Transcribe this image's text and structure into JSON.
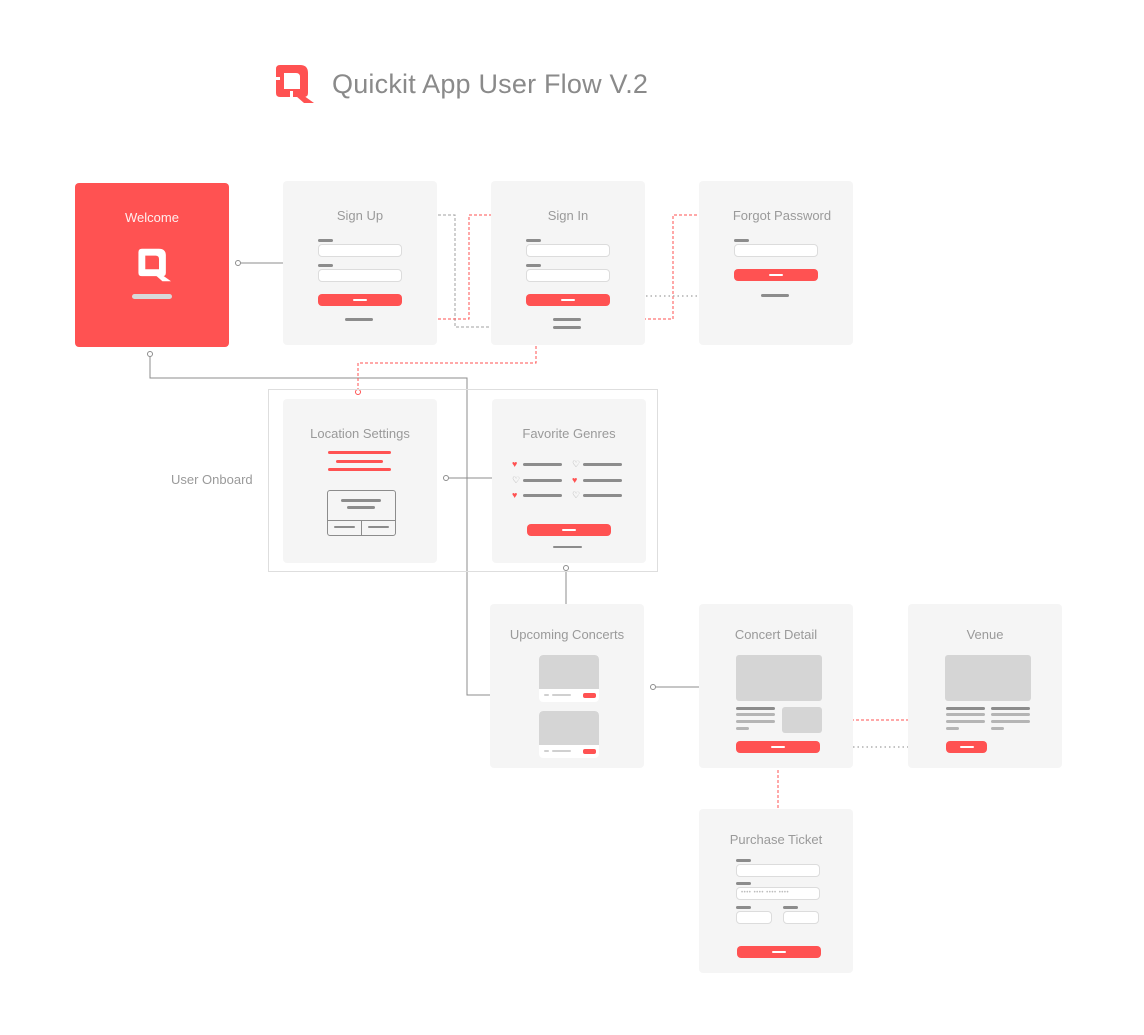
{
  "header": {
    "title": "Quickit App User Flow V.2",
    "logo_icon": "quickit-q-logo-icon"
  },
  "colors": {
    "accent": "#ff5252",
    "card_bg": "#f5f5f5",
    "placeholder": "#d5d5d5",
    "line_gray": "#8c8c8c"
  },
  "screens": {
    "welcome": {
      "title": "Welcome"
    },
    "sign_up": {
      "title": "Sign Up"
    },
    "sign_in": {
      "title": "Sign In"
    },
    "forgot_password": {
      "title": "Forgot Password"
    },
    "location_settings": {
      "title": "Location Settings"
    },
    "favorite_genres": {
      "title": "Favorite Genres",
      "genres": [
        {
          "favorited": true
        },
        {
          "favorited": false
        },
        {
          "favorited": false
        },
        {
          "favorited": true
        },
        {
          "favorited": true
        },
        {
          "favorited": false
        }
      ],
      "heart_on": "♥",
      "heart_off": "♡"
    },
    "upcoming_concerts": {
      "title": "Upcoming Concerts"
    },
    "concert_detail": {
      "title": "Concert Detail"
    },
    "venue": {
      "title": "Venue"
    },
    "purchase_ticket": {
      "title": "Purchase Ticket",
      "card_placeholder": "•••• •••• •••• ••••"
    }
  },
  "groups": {
    "user_onboard": {
      "label": "User Onboard"
    }
  }
}
